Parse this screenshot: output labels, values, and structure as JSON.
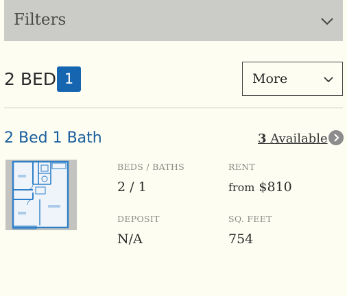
{
  "filters": {
    "label": "Filters",
    "icon": "chevron-down-icon"
  },
  "bed_group": {
    "heading": "2 BED",
    "count": "1"
  },
  "more_select": {
    "label": "More",
    "icon": "chevron-down-icon"
  },
  "floorplan": {
    "name": "2 Bed 1 Bath",
    "available_count": "3",
    "available_text": "Available",
    "arrow_icon": "chevron-right-circle-icon",
    "image_icon": "floorplan-image",
    "specs": {
      "beds_baths_label": "BEDS / BATHS",
      "beds_baths_value": "2 / 1",
      "rent_label": "RENT",
      "rent_prefix": "from",
      "rent_value": "$810",
      "deposit_label": "DEPOSIT",
      "deposit_value": "N/A",
      "sqft_label": "SQ. FEET",
      "sqft_value": "754"
    }
  },
  "colors": {
    "background": "#fdfdf2",
    "filters_bar": "#cbcbc7",
    "badge": "#1565b0",
    "link_blue": "#1a5e9c",
    "floorplan_line": "#2f7fc8"
  }
}
